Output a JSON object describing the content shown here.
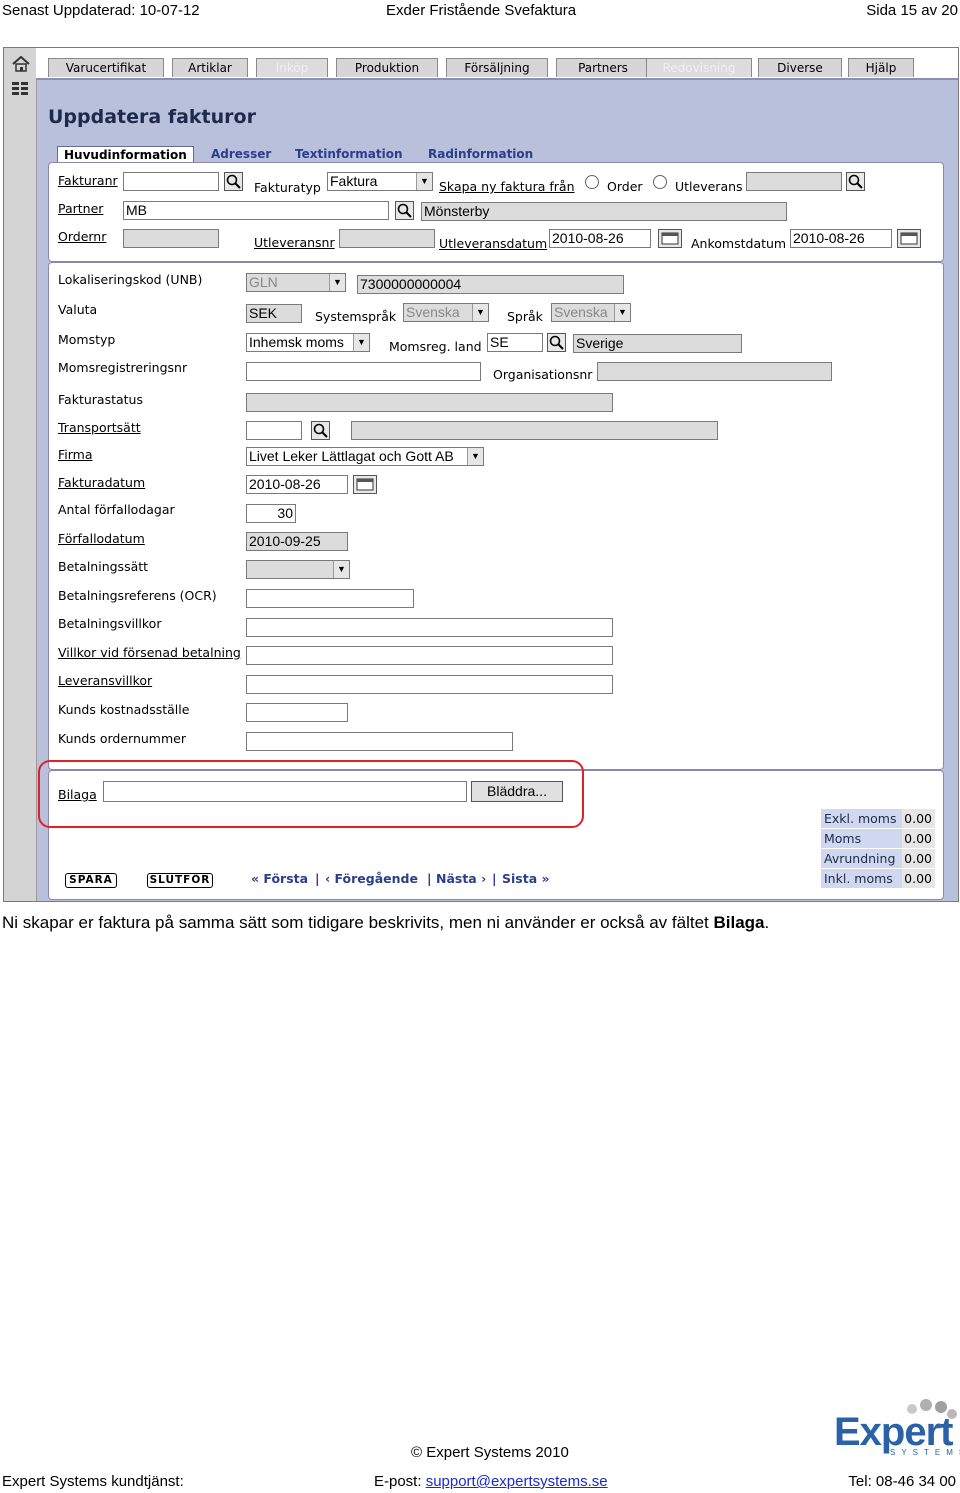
{
  "header": {
    "left": "Senast Uppdaterad: 10-07-12",
    "center": "Exder Fristående Svefaktura",
    "right": "Sida 15 av 20"
  },
  "nav": [
    "Varucertifikat",
    "Artiklar",
    "Inköp",
    "Produktion",
    "Försäljning",
    "Partners",
    "Redovisning",
    "Diverse",
    "Hjälp"
  ],
  "title": "Uppdatera fakturor",
  "tabs": [
    "Huvudinformation",
    "Adresser",
    "Textinformation",
    "Radinformation"
  ],
  "labels": {
    "fakturanr": "Fakturanr",
    "fakturatyp": "Fakturatyp",
    "skapa": "Skapa ny faktura från",
    "order": "Order",
    "utleverans": "Utleverans",
    "partner": "Partner",
    "ordernr": "Ordernr",
    "utleveransnr": "Utleveransnr",
    "utleveransdatum": "Utleveransdatum",
    "ankomstdatum": "Ankomstdatum",
    "lokal": "Lokaliseringskod (UNB)",
    "valuta": "Valuta",
    "systemsprak": "Systemspråk",
    "sprak": "Språk",
    "momstyp": "Momstyp",
    "momsregland": "Momsreg. land",
    "momsregnr": "Momsregistreringsnr",
    "orgnr": "Organisationsnr",
    "fakturastatus": "Fakturastatus",
    "transportsatt": "Transportsätt",
    "firma": "Firma",
    "fakturadatum": "Fakturadatum",
    "forfallodagar": "Antal förfallodagar",
    "forfallodatum": "Förfallodatum",
    "betalningssatt": "Betalningssätt",
    "ocr": "Betalningsreferens (OCR)",
    "betvillkor": "Betalningsvillkor",
    "forsenad": "Villkor vid försenad betalning",
    "levvillkor": "Leveransvillkor",
    "kostnad": "Kunds kostnadsställe",
    "kundorder": "Kunds ordernummer",
    "bilaga": "Bilaga"
  },
  "values": {
    "fakturatyp": "Faktura",
    "partner": "MB",
    "partner_name": "Mönsterby",
    "utleveransdatum": "2010-08-26",
    "ankomstdatum": "2010-08-26",
    "lokal": "GLN",
    "lokal_code": "7300000000004",
    "valuta": "SEK",
    "systemsprak": "Svenska",
    "sprak": "Svenska",
    "momstyp": "Inhemsk moms",
    "momsregland": "SE",
    "momsregland_name": "Sverige",
    "firma": "Livet Leker Lättlagat och Gott AB",
    "fakturadatum": "2010-08-26",
    "forfallodagar": "30",
    "forfallodatum": "2010-09-25"
  },
  "buttons": {
    "bladdra": "Bläddra...",
    "spara": "SPARA",
    "slutfor": "SLUTFÖR"
  },
  "pager": {
    "first": "« Första",
    "prev": "‹ Föregående",
    "next": "Nästa ›",
    "last": "Sista »",
    "sep": "|"
  },
  "summary": [
    {
      "label": "Exkl. moms",
      "value": "0.00"
    },
    {
      "label": "Moms",
      "value": "0.00"
    },
    {
      "label": "Avrundning",
      "value": "0.00"
    },
    {
      "label": "Inkl. moms",
      "value": "0.00"
    }
  ],
  "caption": {
    "text": "Ni skapar er faktura på samma sätt som tidigare beskrivits, men ni använder er också av fältet ",
    "bold": "Bilaga",
    "end": "."
  },
  "footer": {
    "copyright": "© Expert Systems 2010",
    "support": "Expert Systems kundtjänst:",
    "email_label": "E-post: ",
    "email": "support@expertsystems.se",
    "tel": "Tel: 08-46 34 00",
    "logo_main": "Expert",
    "logo_sub": "SYSTEMS"
  },
  "colors": {
    "accent": "#2a3e8c",
    "highlight": "#e0202a",
    "panel_bg": "#b8c0dc"
  }
}
